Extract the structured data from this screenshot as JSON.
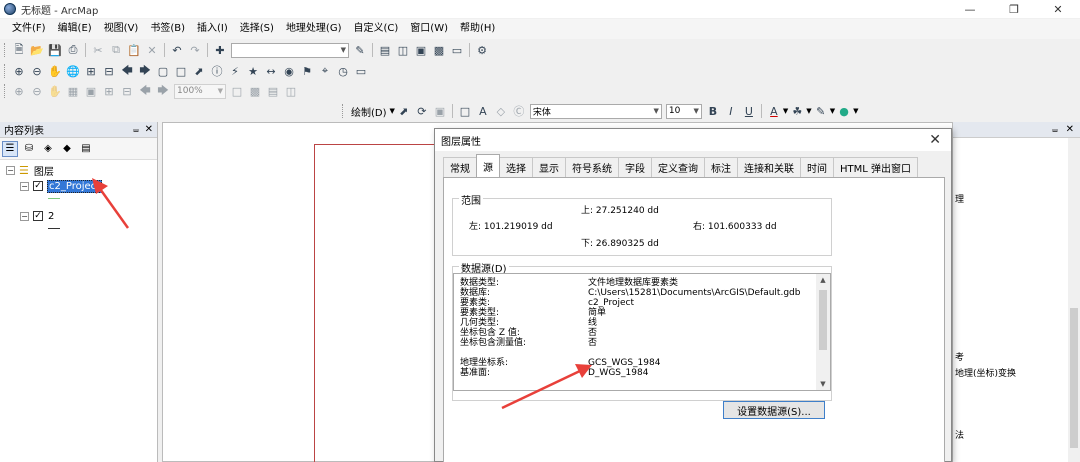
{
  "window": {
    "title": "无标题 - ArcMap"
  },
  "menu": [
    "文件(F)",
    "编辑(E)",
    "视图(V)",
    "书签(B)",
    "插入(I)",
    "选择(S)",
    "地理处理(G)",
    "自定义(C)",
    "窗口(W)",
    "帮助(H)"
  ],
  "toolbar": {
    "scale_value": "",
    "zoom_value": "100%",
    "draw_label": "绘制(D)",
    "font_name": "宋体",
    "font_size": "10",
    "bold": "B",
    "italic": "I",
    "underline": "U",
    "text_a": "A"
  },
  "toc": {
    "title": "内容列表",
    "root_label": "图层",
    "layers": [
      {
        "name": "c2_Project",
        "checked": true,
        "selected": true,
        "symbol_color": "#7fc97f"
      },
      {
        "name": "2",
        "checked": true,
        "selected": false,
        "symbol_color": "#333333"
      }
    ]
  },
  "right_panel": {
    "labels": [
      "理",
      "考",
      "地理(坐标)变换",
      "法"
    ]
  },
  "dialog": {
    "title": "图层属性",
    "tabs": [
      "常规",
      "源",
      "选择",
      "显示",
      "符号系统",
      "字段",
      "定义查询",
      "标注",
      "连接和关联",
      "时间",
      "HTML 弹出窗口"
    ],
    "active_tab": "源",
    "extent": {
      "group_title": "范围",
      "top": "上:  27.251240 dd",
      "left": "左:  101.219019 dd",
      "right": "右:   101.600333 dd",
      "bottom": "下:  26.890325 dd"
    },
    "datasource": {
      "group_title": "数据源(D)",
      "rows": [
        {
          "label": "数据类型:",
          "value": "文件地理数据库要素类"
        },
        {
          "label": "数据库:",
          "value": "C:\\Users\\15281\\Documents\\ArcGIS\\Default.gdb"
        },
        {
          "label": "要素类:",
          "value": "c2_Project"
        },
        {
          "label": "要素类型:",
          "value": "简单"
        },
        {
          "label": "几何类型:",
          "value": "线"
        },
        {
          "label": "坐标包含 Z 值:",
          "value": "否"
        },
        {
          "label": "坐标包含测量值:",
          "value": "否"
        },
        {
          "label": "",
          "value": ""
        },
        {
          "label": "地理坐标系:",
          "value": "GCS_WGS_1984"
        },
        {
          "label": "基准面:",
          "value": "D_WGS_1984"
        }
      ]
    },
    "set_source_button": "设置数据源(S)..."
  },
  "colors": {
    "selection": "#3377d6",
    "annotation_arrow": "#e8403a",
    "map_frame": "#bb4444"
  }
}
